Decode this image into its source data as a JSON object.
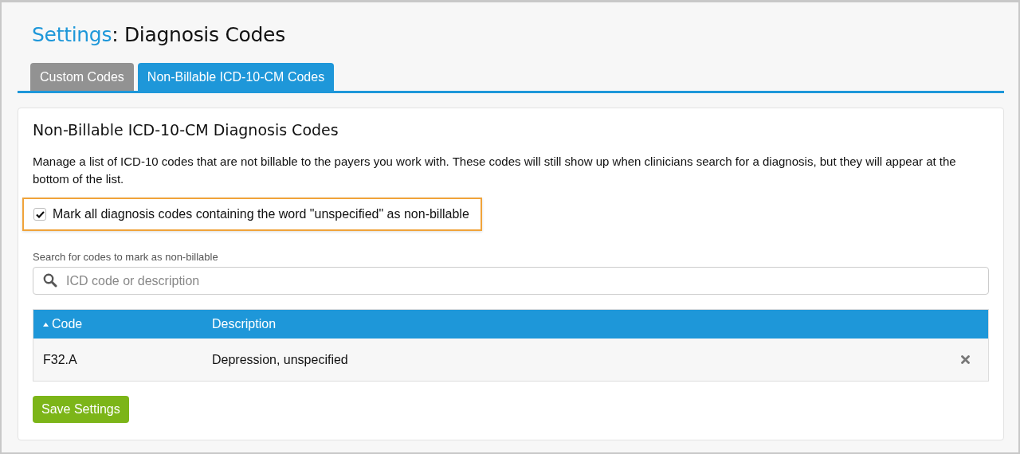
{
  "page_title": {
    "link": "Settings",
    "text": ": Diagnosis Codes"
  },
  "tabs": [
    {
      "label": "Custom Codes",
      "selected": false
    },
    {
      "label": "Non-Billable ICD-10-CM Codes",
      "selected": true
    }
  ],
  "panel": {
    "heading": "Non-Billable ICD-10-CM Diagnosis Codes",
    "description": "Manage a list of ICD-10 codes that are not billable to the payers you work with. These codes will still show up when clinicians search for a diagnosis, but they will appear at the bottom of the list.",
    "checkbox": {
      "label": "Mark all diagnosis codes containing the word \"unspecified\" as non-billable",
      "checked": true,
      "highlighted": true
    },
    "search": {
      "label": "Search for codes to mark as non-billable",
      "placeholder": "ICD code or description"
    },
    "table": {
      "columns": [
        {
          "label": "Code",
          "sorted": true
        },
        {
          "label": "Description",
          "sorted": false
        }
      ],
      "rows": [
        {
          "code": "F32.A",
          "description": "Depression, unspecified"
        }
      ]
    },
    "save_button": "Save Settings"
  }
}
